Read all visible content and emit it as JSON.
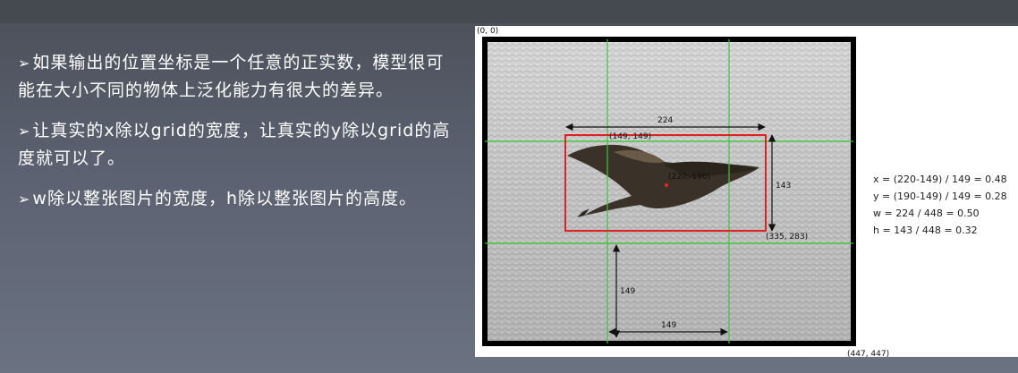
{
  "bullets": [
    {
      "marker": "➢",
      "text": "如果输出的位置坐标是一个任意的正实数，模型很可能在大小不同的物体上泛化能力有很大的差异。"
    },
    {
      "marker": "➢",
      "text": "让真实的x除以grid的宽度，让真实的y除以grid的高度就可以了。"
    },
    {
      "marker": "➢",
      "text": "w除以整张图片的宽度，h除以整张图片的高度。"
    }
  ],
  "figure": {
    "origin_label": "(0, 0)",
    "corner_label": "(447, 447)",
    "top_left_label": "(149, 149)",
    "center_label": "(220, 190)",
    "bottom_right_label": "(335, 283)",
    "width_label": "224",
    "height_label": "143",
    "grid_height_label": "149",
    "grid_width_label": "149",
    "formulas": [
      "x = (220-149) / 149 = 0.48",
      "y = (190-149) / 149 = 0.28",
      "w = 224 / 448 = 0.50",
      "h = 143 / 448 = 0.32"
    ],
    "colors": {
      "grid": "#33cc33",
      "box": "#dd2222",
      "frame": "#000000"
    }
  }
}
